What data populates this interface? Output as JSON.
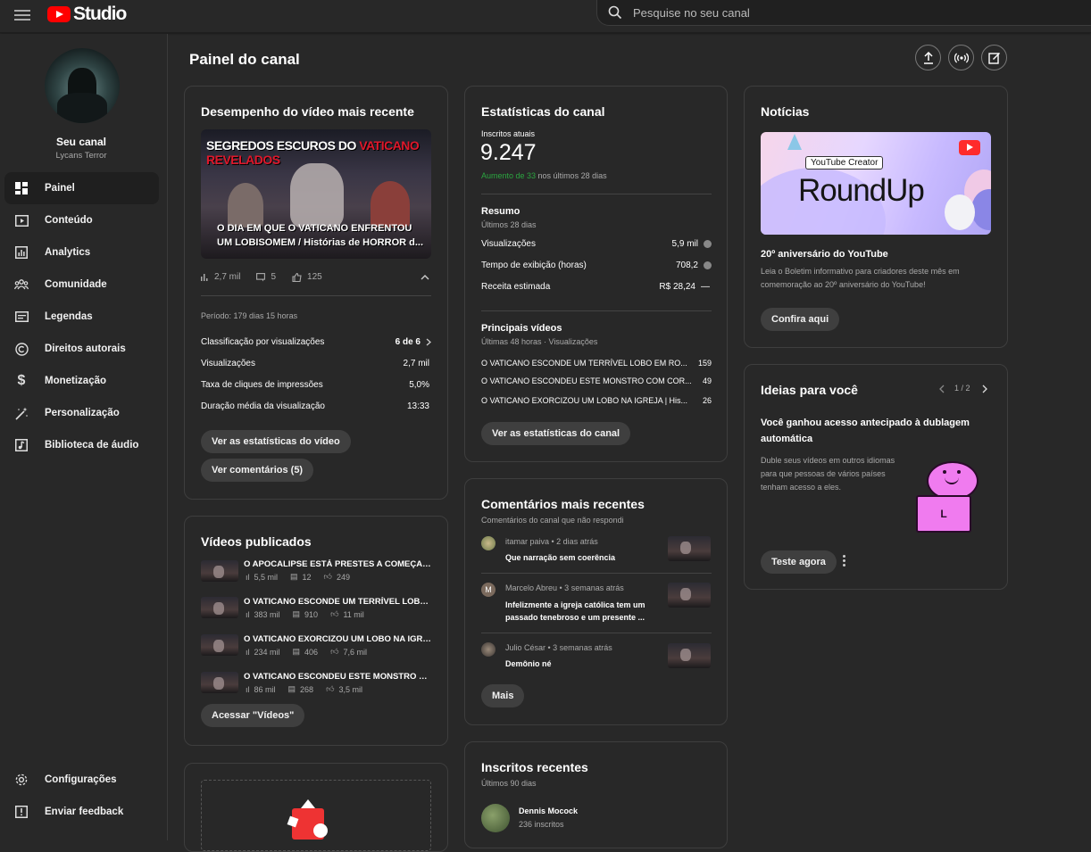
{
  "app": {
    "name": "Studio"
  },
  "search": {
    "placeholder": "Pesquise no seu canal"
  },
  "channel": {
    "name": "Seu canal",
    "handle": "Lycans Terror"
  },
  "nav": {
    "items": [
      {
        "label": "Painel",
        "icon": "dashboard-icon",
        "active": true
      },
      {
        "label": "Conteúdo",
        "icon": "content-icon"
      },
      {
        "label": "Analytics",
        "icon": "analytics-icon"
      },
      {
        "label": "Comunidade",
        "icon": "community-icon"
      },
      {
        "label": "Legendas",
        "icon": "subtitles-icon"
      },
      {
        "label": "Direitos autorais",
        "icon": "copyright-icon"
      },
      {
        "label": "Monetização",
        "icon": "dollar-icon"
      },
      {
        "label": "Personalização",
        "icon": "magic-wand-icon"
      },
      {
        "label": "Biblioteca de áudio",
        "icon": "audio-library-icon"
      }
    ],
    "bottom": [
      {
        "label": "Configurações",
        "icon": "gear-icon"
      },
      {
        "label": "Enviar feedback",
        "icon": "feedback-icon"
      }
    ]
  },
  "page": {
    "title": "Painel do canal"
  },
  "latest_video": {
    "title": "Desempenho do vídeo mais recente",
    "thumb_headline_white": "SEGREDOS ESCUROS DO ",
    "thumb_headline_red": "VATICANO REVELADOS",
    "thumb_caption": "O DIA EM QUE O VATICANO ENFRENTOU UM LOBISOMEM / Histórias de HORROR d...",
    "views": "2,7 mil",
    "comments": "5",
    "likes": "125",
    "period": "Período: 179 dias 15 horas",
    "metrics": [
      {
        "label": "Classificação por visualizações",
        "value": "6 de 6"
      },
      {
        "label": "Visualizações",
        "value": "2,7 mil"
      },
      {
        "label": "Taxa de cliques de impressões",
        "value": "5,0%"
      },
      {
        "label": "Duração média da visualização",
        "value": "13:33"
      }
    ],
    "btn_stats": "Ver as estatísticas do vídeo",
    "btn_comments": "Ver comentários (5)"
  },
  "published": {
    "title": "Vídeos publicados",
    "videos": [
      {
        "title": "O APOCALIPSE ESTÁ PRESTES A COMEÇAR P...",
        "views": "5,5 mil",
        "comments": "12",
        "likes": "249"
      },
      {
        "title": "O VATICANO ESCONDE UM TERRÍVEL LOBO E...",
        "views": "383 mil",
        "comments": "910",
        "likes": "11 mil"
      },
      {
        "title": "O VATICANO EXORCIZOU UM LOBO NA IGREJ...",
        "views": "234 mil",
        "comments": "406",
        "likes": "7,6 mil"
      },
      {
        "title": "O VATICANO ESCONDEU ESTE MONSTRO CO...",
        "views": "86 mil",
        "comments": "268",
        "likes": "3,5 mil"
      }
    ],
    "btn": "Acessar \"Vídeos\""
  },
  "stats": {
    "title": "Estatísticas do canal",
    "subs_label": "Inscritos atuais",
    "subs_value": "9.247",
    "growth_green": "Aumento de 33",
    "growth_rest": " nos últimos 28 dias",
    "summary_title": "Resumo",
    "summary_sub": "Últimos 28 dias",
    "summary": [
      {
        "label": "Visualizações",
        "value": "5,9 mil"
      },
      {
        "label": "Tempo de exibição (horas)",
        "value": "708,2"
      },
      {
        "label": "Receita estimada",
        "value": "R$ 28,24"
      }
    ],
    "top_title": "Principais vídeos",
    "top_sub": "Últimas 48 horas · Visualizações",
    "top": [
      {
        "title": "O VATICANO ESCONDE UM TERRÍVEL LOBO EM RO...",
        "value": "159"
      },
      {
        "title": "O VATICANO ESCONDEU ESTE MONSTRO COM COR...",
        "value": "49"
      },
      {
        "title": "O VATICANO EXORCIZOU UM LOBO NA IGREJA | His...",
        "value": "26"
      }
    ],
    "btn": "Ver as estatísticas do canal"
  },
  "comments": {
    "title": "Comentários mais recentes",
    "sub": "Comentários do canal que não respondi",
    "items": [
      {
        "meta": "itamar paiva • 2 dias atrás",
        "text": "Que narração sem coerência"
      },
      {
        "meta": "Marcelo Abreu • 3 semanas atrás",
        "text": "Infelizmente a igreja católica tem um passado tenebroso e um presente ...",
        "initial": "M"
      },
      {
        "meta": "Julio César • 3 semanas atrás",
        "text": "Demônio né"
      }
    ],
    "btn": "Mais"
  },
  "recent_subs": {
    "title": "Inscritos recentes",
    "sub": "Últimos 90 dias",
    "items": [
      {
        "name": "Dennis Mocock",
        "count": "236 inscritos"
      }
    ]
  },
  "news": {
    "title": "Notícias",
    "banner_tag": "YouTube Creator",
    "banner_word": "RoundUp",
    "headline": "20º aniversário do YouTube",
    "body": "Leia o Boletim informativo para criadores deste mês em comemoração ao 20º aniversário do YouTube!",
    "btn": "Confira aqui"
  },
  "ideas": {
    "title": "Ideias para você",
    "pager": "1 / 2",
    "headline": "Você ganhou acesso antecipado à dublagem automática",
    "body": "Duble seus vídeos em outros idiomas para que pessoas de vários países tenham acesso a eles.",
    "btn": "Teste agora",
    "illus_letter": "L"
  }
}
